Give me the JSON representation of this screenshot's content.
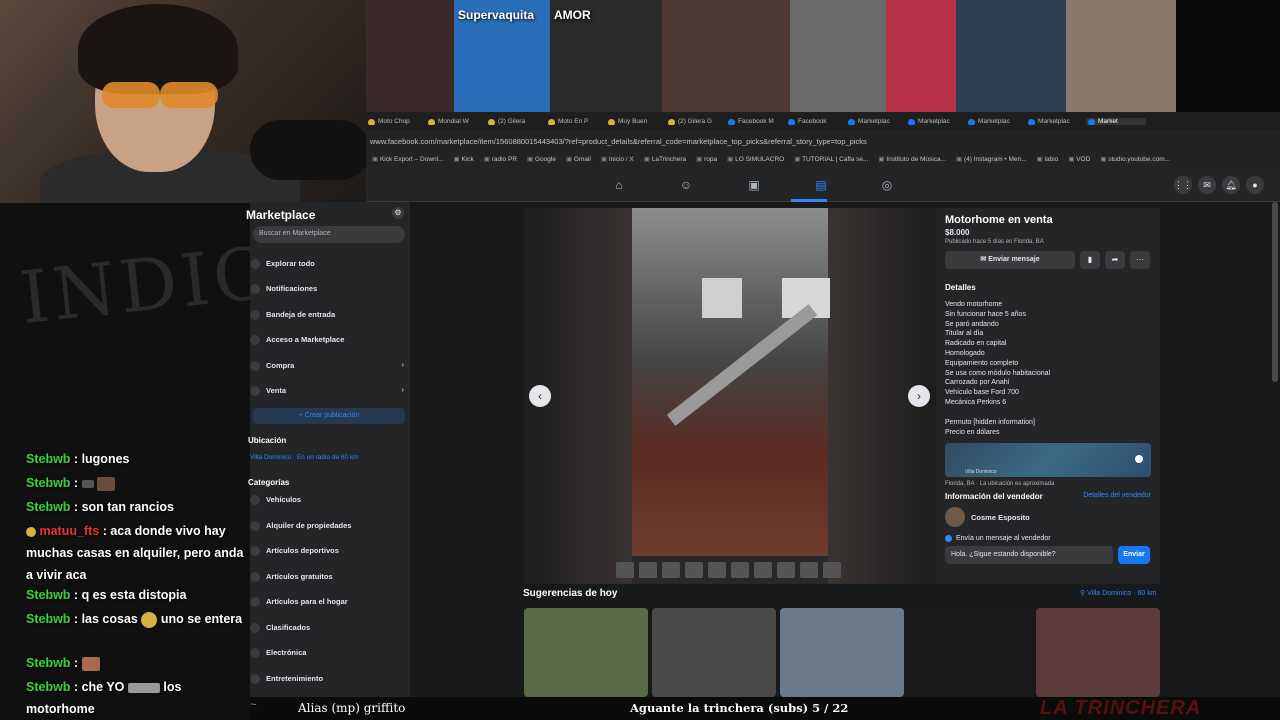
{
  "browser": {
    "url": "www.facebook.com/marketplace/item/1560880015443403/?ref=product_details&referral_code=marketplace_top_picks&referral_story_type=top_picks",
    "tabs": [
      {
        "label": "Moto Chop",
        "icon": "yellow-icon"
      },
      {
        "label": "Mondial W",
        "icon": "yellow-icon"
      },
      {
        "label": "(2) Gilera",
        "icon": "yellow-icon"
      },
      {
        "label": "Moto En P",
        "icon": "yellow-icon"
      },
      {
        "label": "Muy Buen",
        "icon": "yellow-icon"
      },
      {
        "label": "(2) Gilera G",
        "icon": "yellow-icon"
      },
      {
        "label": "Facebook M",
        "icon": "facebook-icon"
      },
      {
        "label": "Facebook",
        "icon": "facebook-icon"
      },
      {
        "label": "Marketplac",
        "icon": "facebook-icon"
      },
      {
        "label": "Marketplac",
        "icon": "facebook-icon"
      },
      {
        "label": "Marketplac",
        "icon": "facebook-icon"
      },
      {
        "label": "Marketplac",
        "icon": "facebook-icon"
      },
      {
        "label": "Market",
        "icon": "facebook-icon"
      }
    ],
    "bookmarks": [
      "Kick Export – Downl...",
      "Kick",
      "radio PR",
      "Google",
      "Gmail",
      "Inicio / X",
      "LaTrinchera",
      "ropa",
      "LO SIMULACRO",
      "TUTORIAL | Cafla se...",
      "Instituto de Música...",
      "(4) Instagram • Men...",
      "labio",
      "VOD",
      "studio.youtube.com..."
    ]
  },
  "thumbnails": [
    {
      "label": "",
      "color": "#3a2a2a"
    },
    {
      "label": "Supervaquita",
      "color": "#2b6fb8"
    },
    {
      "label": "AMOR",
      "color": "#2a2a2a"
    },
    {
      "label": "",
      "color": "#4d3a33"
    },
    {
      "label": "",
      "color": "#6a6a6a"
    },
    {
      "label": "",
      "color": "#b8324a"
    },
    {
      "label": "",
      "color": "#2f3f52"
    },
    {
      "label": "",
      "color": "#8a7a6a"
    }
  ],
  "marketplace": {
    "title": "Marketplace",
    "search_placeholder": "Buscar en Marketplace",
    "nav": [
      "Explorar todo",
      "Notificaciones",
      "Bandeja de entrada",
      "Acceso a Marketplace",
      "Compra",
      "Venta"
    ],
    "create_button": "+ Crear publicación",
    "location_heading": "Ubicación",
    "location_value": "Villa Dominico · En un radio de 60 km",
    "categories_heading": "Categorías",
    "categories": [
      "Vehículos",
      "Alquiler de propiedades",
      "Artículos deportivos",
      "Artículos gratuitos",
      "Artículos para el hogar",
      "Clasificados",
      "Electrónica",
      "Entretenimiento"
    ]
  },
  "listing": {
    "title": "Motorhome en venta",
    "price": "$8.000",
    "posted": "Publicado hace 5 días en Florida, BA",
    "send_message": "Enviar mensaje",
    "details_heading": "Detalles",
    "details": [
      "Vendo motorhome",
      "Sin funcionar hace 5 años",
      "Se paró andando",
      "Titular al día",
      "Radicado en capital",
      "Homologado",
      "Equipamiento completo",
      "Se usa como módulo habitacional",
      "Carrozado por Anahí",
      "Vehículo base Ford 700",
      "Mecánica Perkins 6"
    ],
    "extra": [
      "Permuto [hidden information]",
      "Precio en dólares"
    ],
    "map_label": "Villa Dominico",
    "location_line": "Florida, BA · La ubicación es aproximada",
    "seller_heading": "Información del vendedor",
    "seller_link": "Detalles del vendedor",
    "seller_name": "Cosme Esposito",
    "send_seller_label": "Envía un mensaje al vendedor",
    "message_text": "Hola. ¿Sigue estando disponible?",
    "send_button": "Enviar"
  },
  "suggestions": {
    "title": "Sugerencias de hoy",
    "location": "Villa Dominico · 60 km",
    "cards": [
      {
        "color": "#5b6b4a"
      },
      {
        "color": "#4a4a4a"
      },
      {
        "color": "#6b7a8a"
      },
      {
        "color": "#1a1a1a"
      },
      {
        "color": "#5a3a3a"
      }
    ]
  },
  "chat": [
    {
      "user": "Stebwb",
      "text": "lugones",
      "emote": "emote"
    },
    {
      "user": "Stebwb",
      "text": "",
      "emote": "Amigo"
    },
    {
      "user": "Stebwb",
      "text": "son tan rancios",
      "emote": ""
    },
    {
      "user": "matuu_fts",
      "text": "aca donde vivo hay muchas casas en alquiler, pero anda a vivir aca",
      "emote": ""
    },
    {
      "user": "Stebwb",
      "text": "q es esta distopia",
      "emote": ""
    },
    {
      "user": "Stebwb",
      "text": "las cosas",
      "emote": "uno se entera"
    },
    {
      "user": "Stebwb",
      "text": "",
      "emote": ""
    },
    {
      "user": "Stebwb",
      "text": "che YO",
      "emote": "los motorhome"
    }
  ],
  "overlay": {
    "alias": "Alias (mp) griffito",
    "goal": "Aguante la trinchera (subs) 5 / 22",
    "brand": "LA TRINCHERA",
    "graffiti": "INDIC"
  }
}
